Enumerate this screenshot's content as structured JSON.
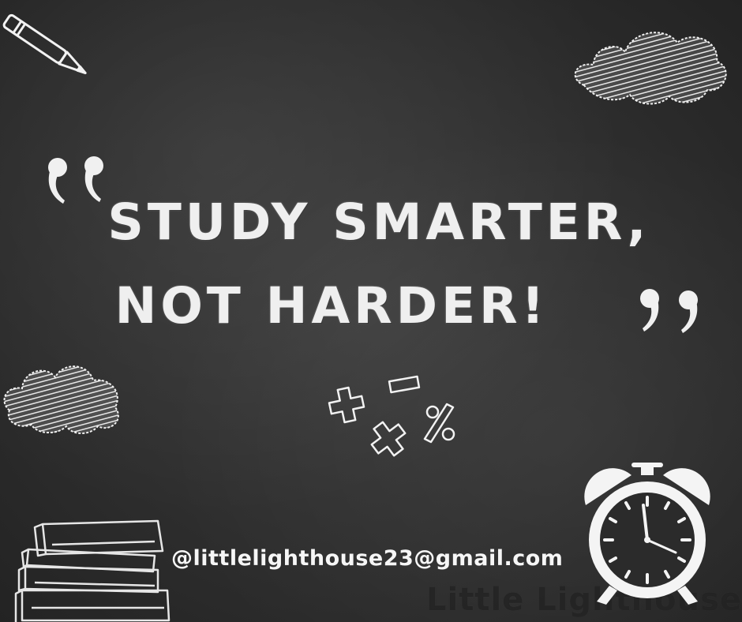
{
  "headline": {
    "line1": "STUDY SMARTER,",
    "line2": "NOT HARDER!"
  },
  "contact_email": "@littlelighthouse23@gmail.com",
  "watermark": "Little Lighthouse",
  "colors": {
    "board": "#2f2f2f",
    "chalk": "#efefef"
  },
  "icons": [
    "pencil-icon",
    "cloud-icon",
    "quote-open-icon",
    "quote-close-icon",
    "math-symbols-icon",
    "books-icon",
    "alarm-clock-icon"
  ]
}
